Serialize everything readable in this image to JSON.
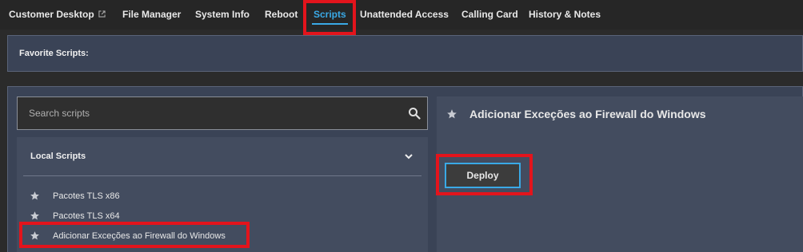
{
  "nav": {
    "tabs": [
      {
        "label": "Customer Desktop",
        "icon": "external-link-icon"
      },
      {
        "label": "File Manager"
      },
      {
        "label": "System Info"
      },
      {
        "label": "Reboot"
      },
      {
        "label": "Scripts",
        "active": true
      },
      {
        "label": "Unattended Access"
      },
      {
        "label": "Calling Card"
      },
      {
        "label": "History & Notes"
      }
    ]
  },
  "favorites": {
    "label": "Favorite Scripts:"
  },
  "search": {
    "placeholder": "Search scripts",
    "value": ""
  },
  "local_scripts": {
    "title": "Local Scripts",
    "items": [
      {
        "label": "Pacotes TLS x86"
      },
      {
        "label": "Pacotes TLS x64"
      },
      {
        "label": "Adicionar Exceções ao Firewall do Windows",
        "selected": true
      }
    ]
  },
  "detail": {
    "title": "Adicionar Exceções ao Firewall do Windows",
    "deploy_label": "Deploy"
  },
  "colors": {
    "accent": "#3aa9e6",
    "highlight": "#e3141c",
    "panel": "#3a4356",
    "card": "#434c5f"
  }
}
